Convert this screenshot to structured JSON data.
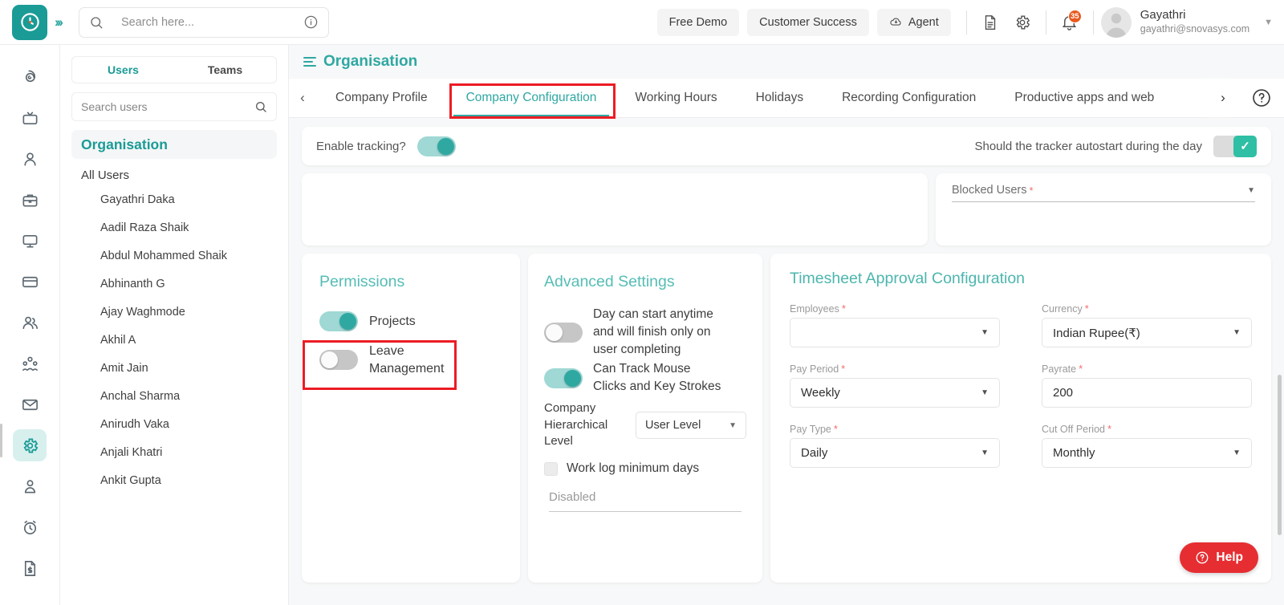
{
  "header": {
    "logo_icon": "clock-logo-icon",
    "expand_icon": "double-chevron-right-icon",
    "search": {
      "placeholder": "Search here...",
      "value": "",
      "icon": "search-icon",
      "info_icon": "info-circle-icon"
    },
    "free_demo": "Free Demo",
    "customer_success": "Customer Success",
    "agent": "Agent",
    "agent_icon": "cloud-download-icon",
    "doc_icon": "document-icon",
    "settings_icon": "gear-icon",
    "bell_icon": "bell-icon",
    "notification_count": "35",
    "user_name": "Gayathri",
    "user_email": "gayathri@snovasys.com",
    "avatar_icon": "avatar-icon",
    "caret_icon": "chevron-down-icon"
  },
  "rail": [
    {
      "icon": "spiral-dashboard-icon",
      "active": false
    },
    {
      "icon": "tv-icon",
      "active": false
    },
    {
      "icon": "person-icon",
      "active": false
    },
    {
      "icon": "briefcase-icon",
      "active": false
    },
    {
      "icon": "monitor-icon",
      "active": false
    },
    {
      "icon": "credit-card-icon",
      "active": false
    },
    {
      "icon": "users-group-icon",
      "active": false
    },
    {
      "icon": "org-chart-icon",
      "active": false
    },
    {
      "icon": "mail-icon",
      "active": false
    },
    {
      "icon": "gear-icon",
      "active": true
    },
    {
      "icon": "user-badge-icon",
      "active": false
    },
    {
      "icon": "alarm-clock-icon",
      "active": false
    },
    {
      "icon": "invoice-dollar-icon",
      "active": false
    }
  ],
  "users_panel": {
    "tabs": [
      {
        "label": "Users",
        "selected": true
      },
      {
        "label": "Teams",
        "selected": false
      }
    ],
    "search": {
      "placeholder": "Search users",
      "value": "",
      "icon": "search-icon"
    },
    "organisation_label": "Organisation",
    "all_users_label": "All Users",
    "users": [
      "Gayathri Daka",
      "Aadil Raza Shaik",
      "Abdul Mohammed Shaik",
      "Abhinanth G",
      "Ajay Waghmode",
      "Akhil A",
      "Amit Jain",
      "Anchal Sharma",
      "Anirudh Vaka",
      "Anjali Khatri",
      "Ankit Gupta"
    ]
  },
  "main": {
    "page_title": "Organisation",
    "menu_icon": "hamburger-icon",
    "prev_icon": "chevron-left-icon",
    "next_icon": "chevron-right-icon",
    "help_circle_icon": "question-circle-icon",
    "tabs": [
      {
        "label": "Company Profile",
        "active": false
      },
      {
        "label": "Company Configuration",
        "active": true
      },
      {
        "label": "Working Hours",
        "active": false
      },
      {
        "label": "Holidays",
        "active": false
      },
      {
        "label": "Recording Configuration",
        "active": false
      },
      {
        "label": "Productive apps and web",
        "active": false
      }
    ],
    "tracking": {
      "enable_label": "Enable tracking?",
      "enable_state": "on",
      "autostart_label": "Should the tracker autostart during the day",
      "autostart_state": "checked",
      "check_icon": "check-icon"
    },
    "blocked_users": {
      "label": "Blocked Users",
      "required": true,
      "value": "",
      "dropdown_icon": "chevron-down-icon"
    },
    "permissions": {
      "title": "Permissions",
      "items": [
        {
          "label": "Projects",
          "state": "on"
        },
        {
          "label": "Leave Management",
          "state": "off"
        }
      ]
    },
    "advanced": {
      "title": "Advanced Settings",
      "items": [
        {
          "label": "Day can start anytime and will finish only on user completing",
          "state": "off"
        },
        {
          "label": "Can Track Mouse Clicks and Key Strokes",
          "state": "on"
        }
      ],
      "hierarchy_label": "Company Hierarchical Level",
      "hierarchy_value": "User Level",
      "worklog_label": "Work log minimum days",
      "worklog_checked": false,
      "disabled_field_value": "Disabled",
      "dropdown_icon": "chevron-down-icon"
    },
    "timesheet": {
      "title": "Timesheet Approval Configuration",
      "fields": [
        {
          "label": "Employees",
          "required": true,
          "value": "",
          "type": "select"
        },
        {
          "label": "Currency",
          "required": true,
          "value": "Indian Rupee(₹)",
          "type": "select"
        },
        {
          "label": "Pay Period",
          "required": true,
          "value": "Weekly",
          "type": "select"
        },
        {
          "label": "Payrate",
          "required": true,
          "value": "200",
          "type": "text"
        },
        {
          "label": "Pay Type",
          "required": true,
          "value": "Daily",
          "type": "select"
        },
        {
          "label": "Cut Off Period",
          "required": true,
          "value": "Monthly",
          "type": "select"
        }
      ],
      "dropdown_icon": "chevron-down-icon"
    },
    "help_button": {
      "label": "Help",
      "icon": "question-circle-icon",
      "color": "#e62e32"
    }
  },
  "theme": {
    "accent": "#2fa8a2",
    "accent_light": "#9fd8d4",
    "badge": "#e8591f",
    "annotation": "#ec1c24"
  }
}
